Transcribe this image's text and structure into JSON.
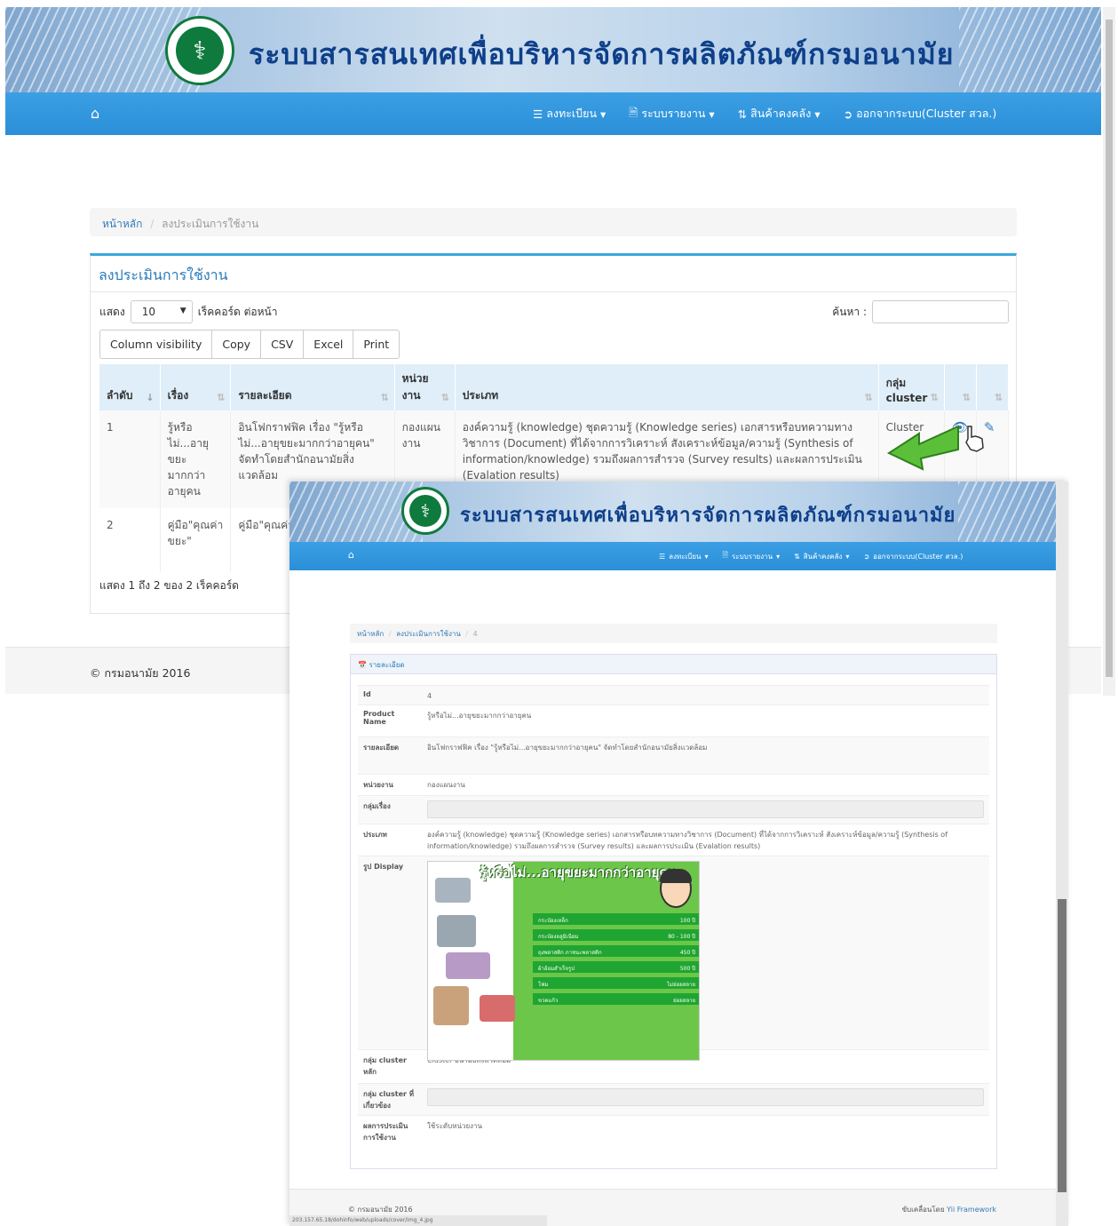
{
  "app": {
    "title": "ระบบสารสนเทศเพื่อบริหารจัดการผลิตภัณฑ์กรมอนามัย",
    "logo_text": "MINISTRY OF PUBLIC HEALTH"
  },
  "nav": {
    "home_icon": "home-icon",
    "register": "ลงทะเบียน",
    "report": "ระบบรายงาน",
    "inventory": "สินค้าคงคลัง",
    "logout": "ออกจากระบบ(Cluster สวล.)"
  },
  "breadcrumb": {
    "home": "หน้าหลัก",
    "current": "ลงประเมินการใช้งาน"
  },
  "panel": {
    "title": "ลงประเมินการใช้งาน"
  },
  "table_controls": {
    "show_label": "แสดง",
    "page_length": "10",
    "per_page_label": "เร็คคอร์ด ต่อหน้า",
    "search_label": "ค้นหา :",
    "buttons": [
      "Column visibility",
      "Copy",
      "CSV",
      "Excel",
      "Print"
    ]
  },
  "table": {
    "headers": [
      "ลำดับ",
      "เรื่อง",
      "รายละเอียด",
      "หน่วย งาน",
      "ประเภท",
      "กลุ่ม cluster",
      "",
      ""
    ],
    "rows": [
      {
        "no": "1",
        "subject": "รู้หรือไม่...อายุขยะมากกว่าอายุคน",
        "detail": "อินโฟกราฟฟิค เรื่อง \"รู้หรือไม่...อายุขยะมากกว่าอายุคน\" จัดทำโดยสำนักอนามัยสิ่งแวดล้อม",
        "unit": "กองแผนงาน",
        "type": "องค์ความรู้ (knowledge) ชุดความรู้ (Knowledge series) เอกสารหรือบทความทางวิชาการ (Document) ที่ได้จากการวิเคราะห์ สังเคราะห์ข้อมูล/ความรู้ (Synthesis of information/knowledge) รวมถึงผลการสำรวจ (Survey results) และผลการประเมิน (Evalation results)",
        "cluster": "Cluster"
      },
      {
        "no": "2",
        "subject": "คู่มือ\"คุณค่าขยะ\"",
        "detail": "คู่มือ\"คุณค่า",
        "unit": "",
        "type": "",
        "cluster": ""
      }
    ],
    "info": "แสดง 1 ถึง 2 ของ 2 เร็คคอร์ด"
  },
  "footer": {
    "copyright": "© กรมอนามัย 2016"
  },
  "overlay": {
    "breadcrumb": {
      "home": "หน้าหลัก",
      "mid": "ลงประเมินการใช้งาน",
      "current": "4"
    },
    "panel_title": "รายละเอียด",
    "fields": [
      {
        "k": "Id",
        "v": "4"
      },
      {
        "k": "Product Name",
        "v": "รู้หรือไม่...อายุขยะมากกว่าอายุคน"
      },
      {
        "k": "รายละเอียด",
        "v": "อินโฟกราฟฟิค เรื่อง \"รู้หรือไม่...อายุขยะมากกว่าอายุคน\" จัดทำโดยสำนักอนามัยสิ่งแวดล้อม"
      },
      {
        "k": "หน่วยงาน",
        "v": "กองแผนงาน"
      },
      {
        "k": "กลุ่มเรื่อง",
        "v": ""
      },
      {
        "k": "ประเภท",
        "v": "องค์ความรู้ (knowledge) ชุดความรู้ (Knowledge series) เอกสารหรือบทความทางวิชาการ (Document) ที่ได้จากการวิเคราะห์ สังเคราะห์ข้อมูล/ความรู้ (Synthesis of information/knowledge) รวมถึงผลการสำรวจ (Survey results) และผลการประเมิน (Evalation results)"
      },
      {
        "k": "รูป Display",
        "v": ""
      },
      {
        "k": "กลุ่ม cluster หลัก",
        "v": "Cluster อนามัยสิ่งแวดล้อม"
      },
      {
        "k": "กลุ่ม cluster ที่เกี่ยวข้อง",
        "v": ""
      },
      {
        "k": "ผลการประเมินการใช้งาน",
        "v": "ใช้ระดับหน่วยงาน"
      }
    ],
    "poster": {
      "title": "รู้หรือไม่...อายุขยะมากกว่าอายุคน",
      "rows": [
        {
          "item": "กระป๋องเหล็ก",
          "years": "100 ปี"
        },
        {
          "item": "กระป๋องอลูมิเนียม",
          "years": "80 - 100 ปี"
        },
        {
          "item": "ถุงพลาสติก ภาชนะพลาสติก",
          "years": "450 ปี"
        },
        {
          "item": "ผ้าอ้อมสำเร็จรูป",
          "years": "500 ปี"
        },
        {
          "item": "โฟม",
          "years": "ไม่ย่อยสลาย"
        },
        {
          "item": "ขวดแก้ว",
          "years": "ย่อยสลาย"
        }
      ]
    },
    "footer_left": "© กรมอนามัย 2016",
    "footer_right_prefix": "ขับเคลื่อนโดย",
    "footer_right_link": "Yii Framework",
    "status_url": "203.157.65.18/dohinfo/web/uploads/cover/img_4.jpg"
  }
}
